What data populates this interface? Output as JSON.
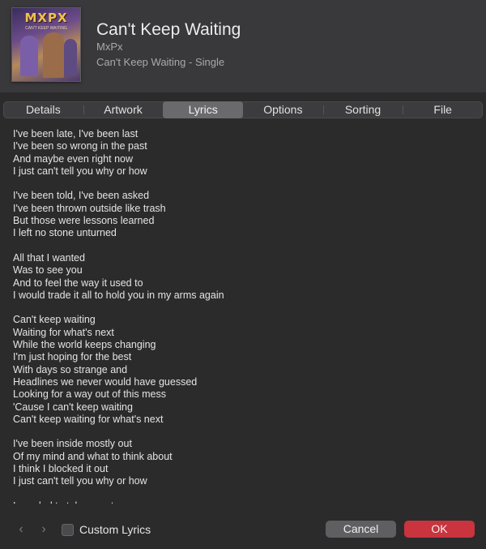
{
  "header": {
    "artwork_text": "MXPX",
    "artwork_subtext": "CAN'T KEEP WAITING",
    "title": "Can't Keep Waiting",
    "artist": "MxPx",
    "album": "Can't Keep Waiting - Single"
  },
  "tabs": [
    {
      "label": "Details"
    },
    {
      "label": "Artwork"
    },
    {
      "label": "Lyrics",
      "active": true
    },
    {
      "label": "Options"
    },
    {
      "label": "Sorting"
    },
    {
      "label": "File"
    }
  ],
  "lyrics": "I've been late, I've been last\nI've been so wrong in the past\nAnd maybe even right now\nI just can't tell you why or how\n\nI've been told, I've been asked\nI've been thrown outside like trash\nBut those were lessons learned\nI left no stone unturned\n\nAll that I wanted\nWas to see you\nAnd to feel the way it used to\nI would trade it all to hold you in my arms again\n\nCan't keep waiting\nWaiting for what's next\nWhile the world keeps changing\nI'm just hoping for the best\nWith days so strange and\nHeadlines we never would have guessed\nLooking for a way out of this mess\n'Cause I can't keep waiting\nCan't keep waiting for what's next\n\nI've been inside mostly out\nOf my mind and what to think about\nI think I blocked it out\nI just can't tell you why or how\n\nI needed to take a rest",
  "footer": {
    "prev_icon": "chevron-left-icon",
    "next_icon": "chevron-right-icon",
    "custom_lyrics_label": "Custom Lyrics",
    "custom_lyrics_checked": false,
    "cancel_label": "Cancel",
    "ok_label": "OK"
  },
  "colors": {
    "accent_ok": "#c9343e",
    "background": "#2b2b2c",
    "header_background": "#39393b"
  }
}
